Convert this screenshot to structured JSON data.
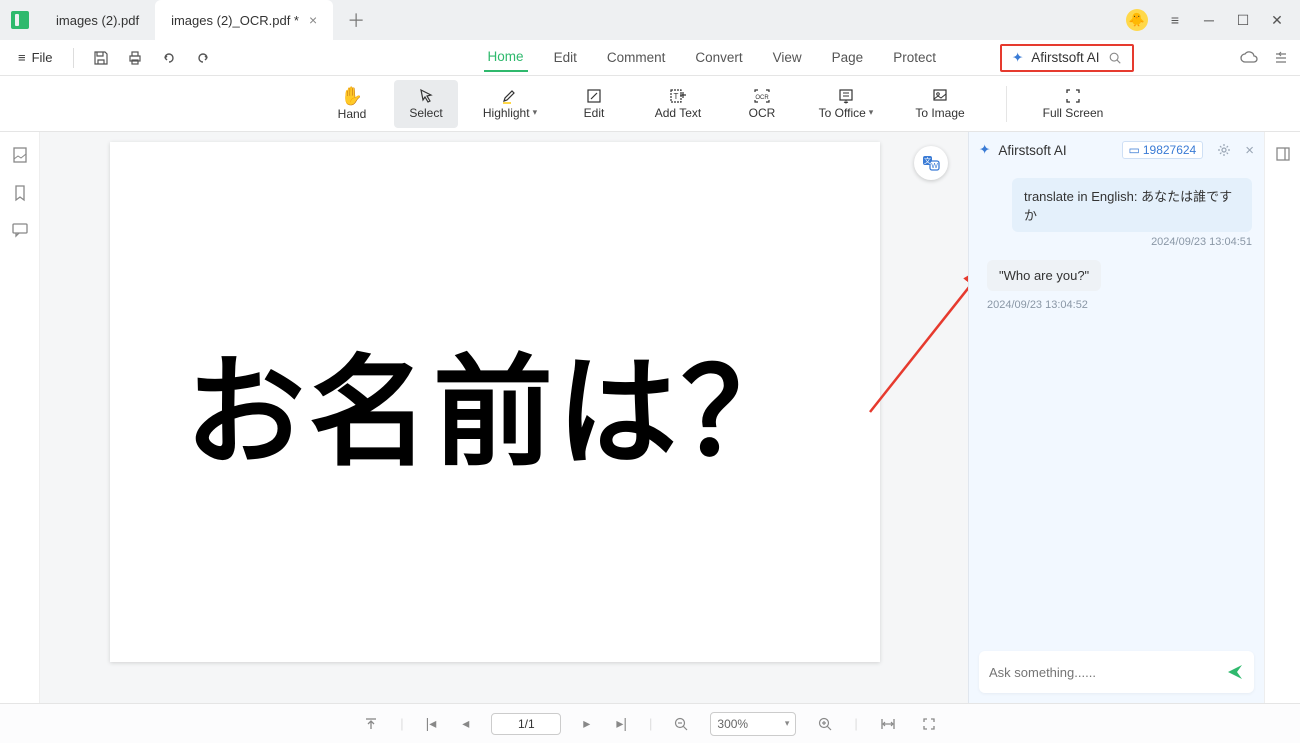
{
  "tabs": [
    {
      "label": "images (2).pdf",
      "active": false
    },
    {
      "label": "images (2)_OCR.pdf *",
      "active": true
    }
  ],
  "file_label": "File",
  "menus": [
    "Home",
    "Edit",
    "Comment",
    "Convert",
    "View",
    "Page",
    "Protect"
  ],
  "menus_active_index": 0,
  "ai_label": "Afirstsoft AI",
  "tools": [
    {
      "key": "hand",
      "label": "Hand"
    },
    {
      "key": "select",
      "label": "Select"
    },
    {
      "key": "highlight",
      "label": "Highlight",
      "dropdown": true
    },
    {
      "key": "edit",
      "label": "Edit"
    },
    {
      "key": "addtext",
      "label": "Add Text"
    },
    {
      "key": "ocr",
      "label": "OCR"
    },
    {
      "key": "tooffice",
      "label": "To Office",
      "dropdown": true
    },
    {
      "key": "toimage",
      "label": "To Image"
    },
    {
      "key": "fullscreen",
      "label": "Full Screen"
    }
  ],
  "tools_active_index": 1,
  "document_text": "お名前は？",
  "ai_panel": {
    "title": "Afirstsoft AI",
    "tokens": "19827624",
    "user_msg": "translate in English: あなたは誰ですか",
    "user_ts": "2024/09/23 13:04:51",
    "ai_msg": "\"Who are you?\"",
    "ai_ts": "2024/09/23 13:04:52",
    "input_placeholder": "Ask something......"
  },
  "status": {
    "page": "1/1",
    "zoom": "300%"
  }
}
